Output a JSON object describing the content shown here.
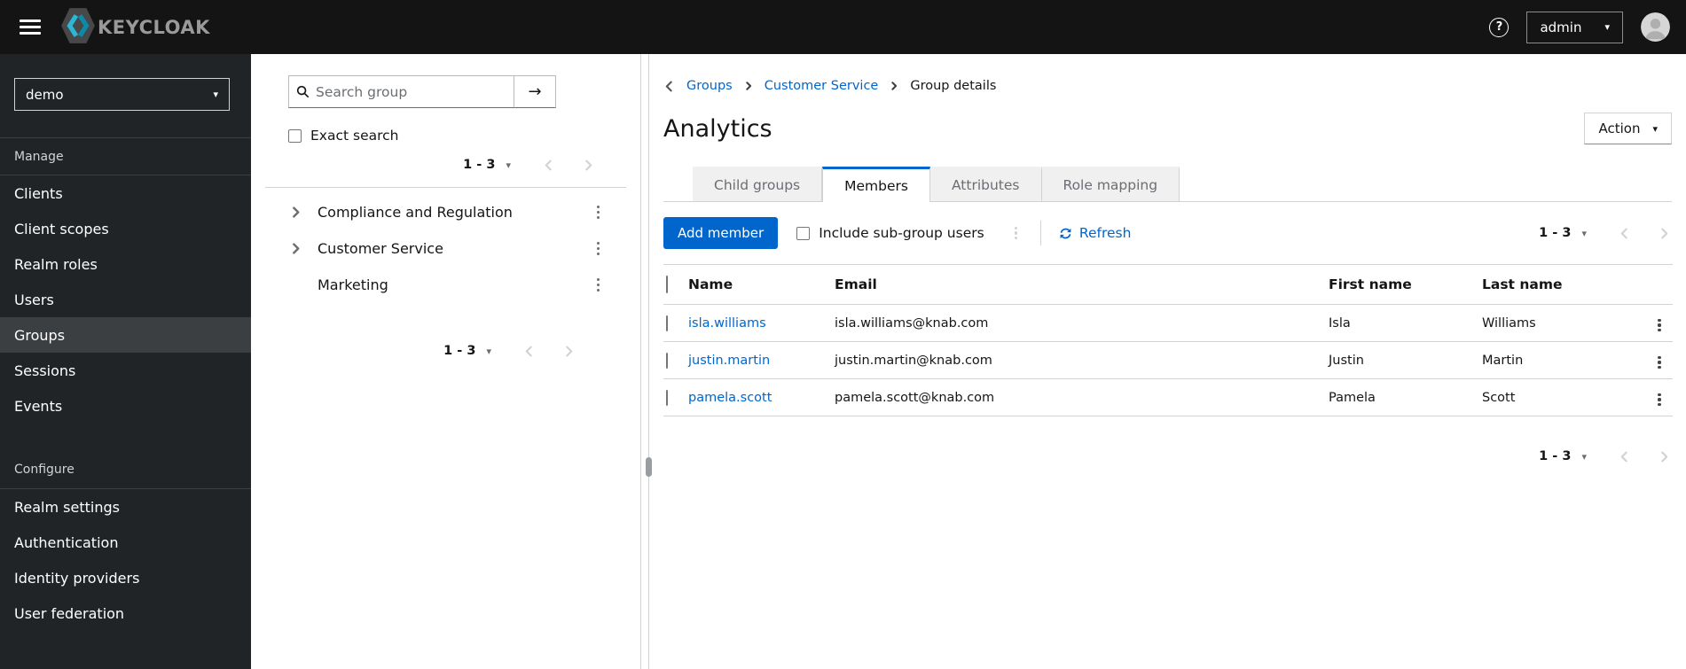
{
  "masthead": {
    "brand": "KEYCLOAK",
    "username": "admin"
  },
  "icons": {
    "caret_down": "▾",
    "arrow_right": "→",
    "question_mark": "?"
  },
  "sidebar": {
    "realm": "demo",
    "sections": [
      {
        "label": "Manage",
        "items": [
          {
            "label": "Clients"
          },
          {
            "label": "Client scopes"
          },
          {
            "label": "Realm roles"
          },
          {
            "label": "Users"
          },
          {
            "label": "Groups",
            "selected": true
          },
          {
            "label": "Sessions"
          },
          {
            "label": "Events"
          }
        ]
      },
      {
        "label": "Configure",
        "items": [
          {
            "label": "Realm settings"
          },
          {
            "label": "Authentication"
          },
          {
            "label": "Identity providers"
          },
          {
            "label": "User federation"
          }
        ]
      }
    ]
  },
  "tree_panel": {
    "search_placeholder": "Search group",
    "exact_search_label": "Exact search",
    "pagination_top": {
      "range": "1 - 3"
    },
    "pagination_bottom": {
      "range": "1 - 3"
    },
    "groups": [
      {
        "label": "Compliance and Regulation",
        "expandable": true
      },
      {
        "label": "Customer Service",
        "expandable": true
      },
      {
        "label": "Marketing",
        "expandable": false
      }
    ]
  },
  "main": {
    "breadcrumb": {
      "items": [
        "Groups",
        "Customer Service",
        "Group details"
      ]
    },
    "title": "Analytics",
    "action_button": "Action",
    "tabs": [
      {
        "label": "Child groups",
        "active": false
      },
      {
        "label": "Members",
        "active": true
      },
      {
        "label": "Attributes",
        "active": false
      },
      {
        "label": "Role mapping",
        "active": false
      }
    ],
    "toolbar": {
      "add_member": "Add member",
      "include_subgroups_label": "Include sub-group users",
      "refresh_label": "Refresh",
      "pagination": {
        "range": "1 - 3"
      }
    },
    "table": {
      "headers": [
        "Name",
        "Email",
        "First name",
        "Last name"
      ],
      "rows": [
        {
          "name": "isla.williams",
          "email": "isla.williams@knab.com",
          "first_name": "Isla",
          "last_name": "Williams"
        },
        {
          "name": "justin.martin",
          "email": "justin.martin@knab.com",
          "first_name": "Justin",
          "last_name": "Martin"
        },
        {
          "name": "pamela.scott",
          "email": "pamela.scott@knab.com",
          "first_name": "Pamela",
          "last_name": "Scott"
        }
      ]
    },
    "pagination_bottom": {
      "range": "1 - 3"
    }
  },
  "colors": {
    "primary": "#0066cc",
    "link": "#0066cc",
    "masthead_bg": "#141414",
    "sidebar_bg": "#212427",
    "nav_selected_bg": "#3c3f42",
    "border": "#d2d2d2",
    "text": "#151515",
    "muted": "#6a6e73",
    "tab_inactive_bg": "#f0f0f0",
    "disabled": "#d2d2d2"
  }
}
